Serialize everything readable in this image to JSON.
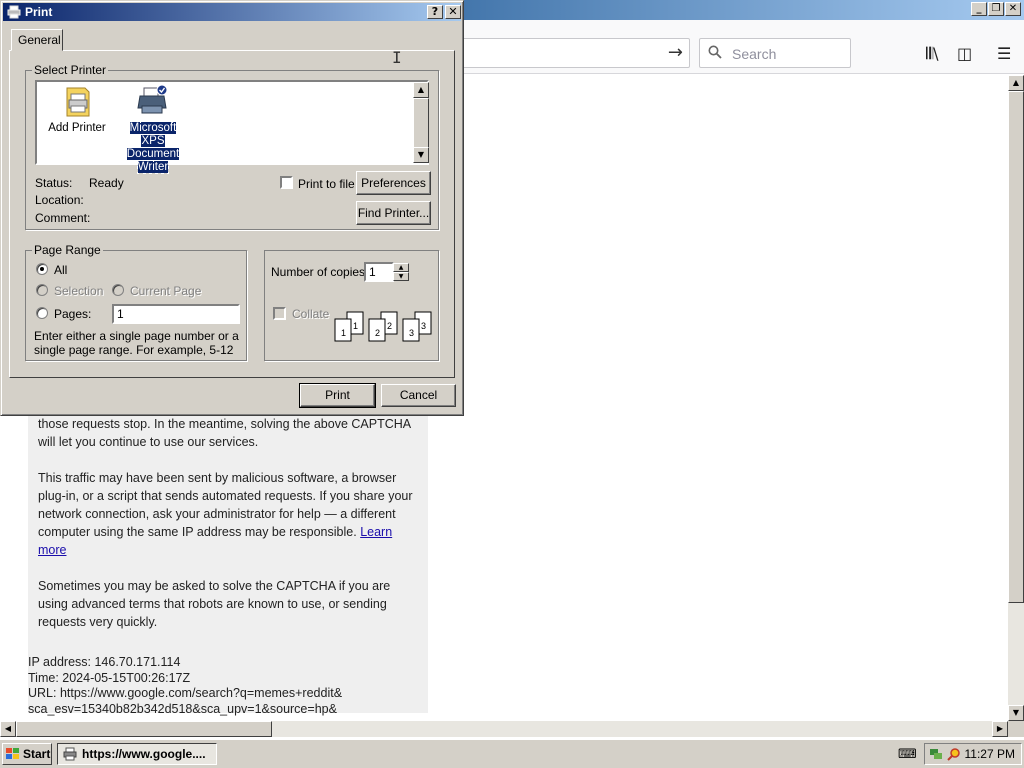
{
  "browser": {
    "search_placeholder": "Search",
    "captcha_paragraphs": [
      "those requests stop. In the meantime, solving the above CAPTCHA will let you continue to use our services.",
      "This traffic may have been sent by malicious software, a browser plug-in, or a script that sends automated requests. If you share your network connection, ask your administrator for help — a different computer using the same IP address may be responsible.",
      "Sometimes you may be asked to solve the CAPTCHA if you are using advanced terms that robots are known to use, or sending requests very quickly."
    ],
    "learn_more": "Learn more",
    "ip_line": "IP address: 146.70.171.114",
    "time_line": "Time: 2024-05-15T00:26:17Z",
    "url_line1": "URL: https://www.google.com/search?q=memes+reddit&",
    "url_line2": "sca_esv=15340b82b342d518&sca_upv=1&source=hp&"
  },
  "taskbar": {
    "start": "Start",
    "task_title": "https://www.google....",
    "clock": "11:27 PM"
  },
  "dialog": {
    "title": "Print",
    "help_glyph": "?",
    "close_glyph": "✕",
    "tab": "General",
    "select_printer_label": "Select Printer",
    "printers": [
      {
        "name": "Add Printer",
        "selected": false
      },
      {
        "name": "Microsoft XPS Document Writer",
        "selected": true
      }
    ],
    "status_label": "Status:",
    "status_value": "Ready",
    "location_label": "Location:",
    "comment_label": "Comment:",
    "print_to_file": "Print to file",
    "preferences": "Preferences",
    "find_printer": "Find Printer...",
    "page_range_label": "Page Range",
    "all": "All",
    "selection": "Selection",
    "current_page": "Current Page",
    "pages": "Pages:",
    "pages_value": "1",
    "pages_hint": "Enter either a single page number or a single page range.  For example, 5-12",
    "copies_label": "Number of copies:",
    "copies_value": "1",
    "collate": "Collate",
    "print_btn": "Print",
    "cancel_btn": "Cancel"
  }
}
